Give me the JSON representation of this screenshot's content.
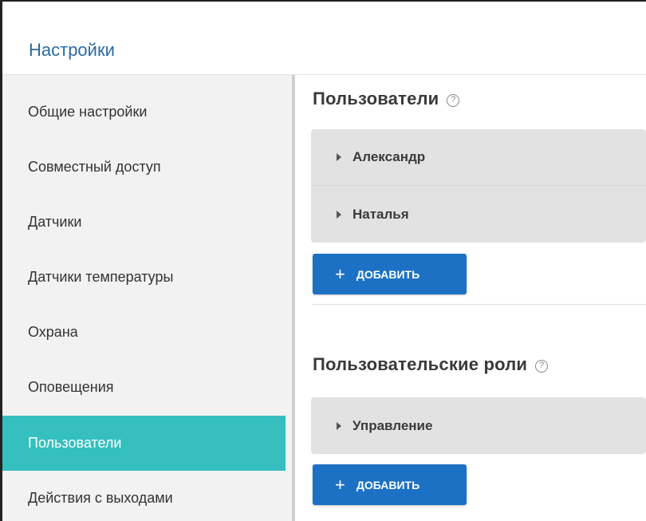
{
  "header": {
    "title": "Настройки"
  },
  "sidebar": {
    "items": [
      {
        "label": "Общие настройки",
        "active": false
      },
      {
        "label": "Совместный доступ",
        "active": false
      },
      {
        "label": "Датчики",
        "active": false
      },
      {
        "label": "Датчики температуры",
        "active": false
      },
      {
        "label": "Охрана",
        "active": false
      },
      {
        "label": "Оповещения",
        "active": false
      },
      {
        "label": "Пользователи",
        "active": true
      },
      {
        "label": "Действия с выходами",
        "active": false
      }
    ]
  },
  "users": {
    "title": "Пользователи",
    "help": "?",
    "items": [
      "Александр",
      "Наталья"
    ],
    "add_label": "ДОБАВИТЬ",
    "add_icon": "+"
  },
  "roles": {
    "title": "Пользовательские роли",
    "help": "?",
    "items": [
      "Управление"
    ],
    "add_label": "ДОБАВИТЬ",
    "add_icon": "+"
  },
  "colors": {
    "accent": "#35bfbf",
    "button": "#1d71c5",
    "title": "#2a6aa3"
  }
}
